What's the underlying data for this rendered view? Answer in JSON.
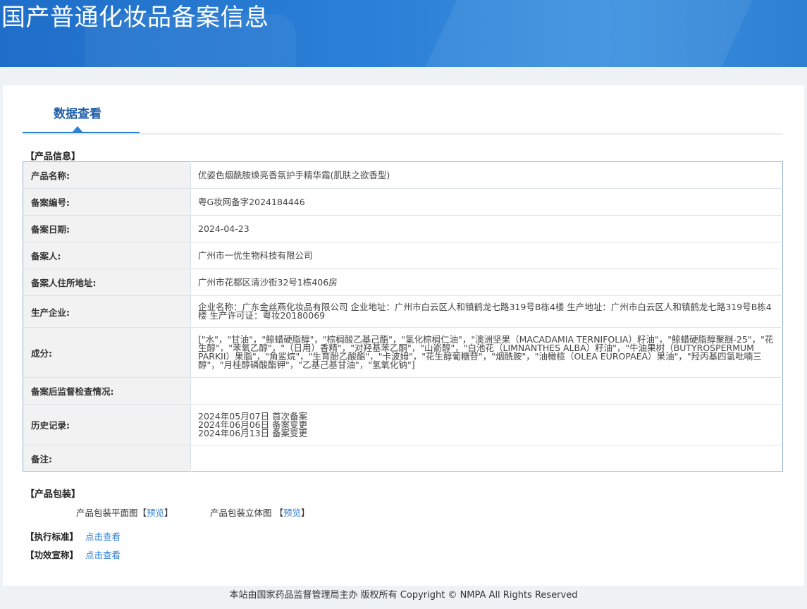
{
  "header": {
    "title": "国产普通化妆品备案信息"
  },
  "tab": {
    "label": "数据查看"
  },
  "product_section": {
    "title": "【产品信息】",
    "rows": [
      {
        "label": "产品名称:",
        "value": "优姿色烟酰胺焕亮香氛护手精华霜(肌肤之欲香型)"
      },
      {
        "label": "备案编号:",
        "value": "粤G妆网备字2024184446"
      },
      {
        "label": "备案日期:",
        "value": "2024-04-23"
      },
      {
        "label": "备案人:",
        "value": "广州市一优生物科技有限公司"
      },
      {
        "label": "备案人住所地址:",
        "value": "广州市花都区清沙街32号1栋406房"
      },
      {
        "label": "生产企业:",
        "value": "企业名称：广东金丝燕化妆品有限公司 企业地址：广州市白云区人和镇鹤龙七路319号B栋4楼 生产地址：广州市白云区人和镇鹤龙七路319号B栋4楼 生产许可证：粤妆20180069"
      },
      {
        "label": "成分:",
        "value": "[\"水\"，\"甘油\"，\"鲸蜡硬脂醇\"，\"棕榈酸乙基己酯\"，\"氢化棕榈仁油\"，\"澳洲坚果（MACADAMIA TERNIFOLIA）籽油\"，\"鲸蜡硬脂醇聚醚-25\"，\"花生醇\"，\"苯氧乙醇\"，\"（日用）香精\"，\"对羟基苯乙酮\"，\"山嵛醇\"，\"白池花（LIMNANTHES ALBA）籽油\"，\"牛油果树（BUTYROSPERMUM PARKII）果脂\"，\"角鲨烷\"，\"生育酚乙酸酯\"，\"卡波姆\"，\"花生醇葡糖苷\"，\"烟酰胺\"，\"油橄榄（OLEA EUROPAEA）果油\"，\"羟丙基四氢吡喃三醇\"，\"月桂醇磷酸酯钾\"，\"乙基己基甘油\"，\"氢氧化钠\"]"
      },
      {
        "label": "备案后监督检查情况:",
        "value": ""
      },
      {
        "label": "历史记录:",
        "value": ""
      },
      {
        "label": "备注:",
        "value": ""
      }
    ],
    "history": [
      "2024年05月07日 首次备案",
      "2024年06月06日 备案变更",
      "2024年06月13日 备案变更"
    ]
  },
  "packaging": {
    "title": "【产品包装】",
    "flat_label": "产品包装平面图【",
    "flat_link": "预览",
    "flat_close": "】",
    "stereo_label": "产品包装立体图 【",
    "stereo_link": "预览",
    "stereo_close": "】"
  },
  "standard": {
    "title": "【执行标准】",
    "link": "点击查看"
  },
  "efficacy": {
    "title": "【功效宣称】",
    "link": "点击查看"
  },
  "footer": {
    "text": "本站由国家药品监督管理局主办 版权所有 Copyright © NMPA All Rights Reserved"
  }
}
